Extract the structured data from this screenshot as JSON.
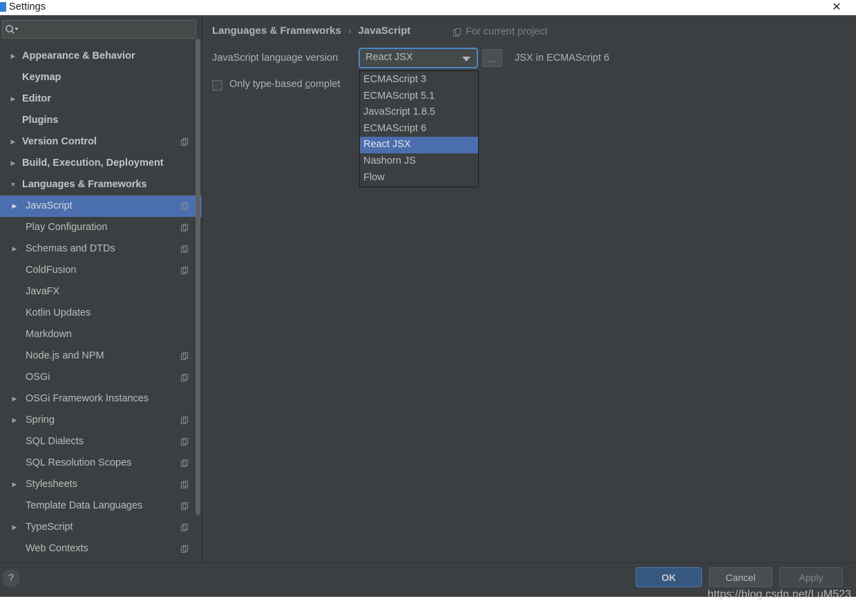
{
  "window": {
    "title": "Settings",
    "icon": "app-icon",
    "close_label": "✕"
  },
  "sidebar": {
    "search": {
      "placeholder": "",
      "value": "",
      "icon": "search-icon"
    },
    "items": [
      {
        "label": "Appearance & Behavior",
        "level": 0,
        "arrow": "▶",
        "expanded": false,
        "project_icon": false,
        "selected": false
      },
      {
        "label": "Keymap",
        "level": 0,
        "arrow": "",
        "expanded": false,
        "project_icon": false,
        "selected": false
      },
      {
        "label": "Editor",
        "level": 0,
        "arrow": "▶",
        "expanded": false,
        "project_icon": false,
        "selected": false
      },
      {
        "label": "Plugins",
        "level": 0,
        "arrow": "",
        "expanded": false,
        "project_icon": false,
        "selected": false
      },
      {
        "label": "Version Control",
        "level": 0,
        "arrow": "▶",
        "expanded": false,
        "project_icon": true,
        "selected": false
      },
      {
        "label": "Build, Execution, Deployment",
        "level": 0,
        "arrow": "▶",
        "expanded": false,
        "project_icon": false,
        "selected": false
      },
      {
        "label": "Languages & Frameworks",
        "level": 0,
        "arrow": "▼",
        "expanded": true,
        "project_icon": false,
        "selected": false
      },
      {
        "label": "JavaScript",
        "level": 1,
        "arrow": "▶",
        "expanded": false,
        "project_icon": true,
        "selected": true
      },
      {
        "label": "Play Configuration",
        "level": 1,
        "arrow": "",
        "expanded": false,
        "project_icon": true,
        "selected": false
      },
      {
        "label": "Schemas and DTDs",
        "level": 1,
        "arrow": "▶",
        "expanded": false,
        "project_icon": true,
        "selected": false
      },
      {
        "label": "ColdFusion",
        "level": 1,
        "arrow": "",
        "expanded": false,
        "project_icon": true,
        "selected": false
      },
      {
        "label": "JavaFX",
        "level": 1,
        "arrow": "",
        "expanded": false,
        "project_icon": false,
        "selected": false
      },
      {
        "label": "Kotlin Updates",
        "level": 1,
        "arrow": "",
        "expanded": false,
        "project_icon": false,
        "selected": false
      },
      {
        "label": "Markdown",
        "level": 1,
        "arrow": "",
        "expanded": false,
        "project_icon": false,
        "selected": false
      },
      {
        "label": "Node.js and NPM",
        "level": 1,
        "arrow": "",
        "expanded": false,
        "project_icon": true,
        "selected": false
      },
      {
        "label": "OSGi",
        "level": 1,
        "arrow": "",
        "expanded": false,
        "project_icon": true,
        "selected": false
      },
      {
        "label": "OSGi Framework Instances",
        "level": 1,
        "arrow": "▶",
        "expanded": false,
        "project_icon": false,
        "selected": false
      },
      {
        "label": "Spring",
        "level": 1,
        "arrow": "▶",
        "expanded": false,
        "project_icon": true,
        "selected": false
      },
      {
        "label": "SQL Dialects",
        "level": 1,
        "arrow": "",
        "expanded": false,
        "project_icon": true,
        "selected": false
      },
      {
        "label": "SQL Resolution Scopes",
        "level": 1,
        "arrow": "",
        "expanded": false,
        "project_icon": true,
        "selected": false
      },
      {
        "label": "Stylesheets",
        "level": 1,
        "arrow": "▶",
        "expanded": false,
        "project_icon": true,
        "selected": false
      },
      {
        "label": "Template Data Languages",
        "level": 1,
        "arrow": "",
        "expanded": false,
        "project_icon": true,
        "selected": false
      },
      {
        "label": "TypeScript",
        "level": 1,
        "arrow": "▶",
        "expanded": false,
        "project_icon": true,
        "selected": false
      },
      {
        "label": "Web Contexts",
        "level": 1,
        "arrow": "",
        "expanded": false,
        "project_icon": true,
        "selected": false
      }
    ]
  },
  "content": {
    "breadcrumb": {
      "parent": "Languages & Frameworks",
      "separator": "›",
      "current": "JavaScript"
    },
    "scope": {
      "icon": "project-scope-icon",
      "label": "For current project"
    },
    "language_version": {
      "label": "JavaScript language version",
      "selected": "React JSX",
      "ellipsis_button": "...",
      "hint": "JSX in ECMAScript 6",
      "options": [
        "ECMAScript 3",
        "ECMAScript 5.1",
        "JavaScript 1.8.5",
        "ECMAScript 6",
        "React JSX",
        "Nashorn JS",
        "Flow"
      ],
      "highlighted_option": "React JSX"
    },
    "checkbox": {
      "label_before": "Only type-based ",
      "label_mnemonic": "c",
      "label_after": "omplet",
      "checked": false
    }
  },
  "footer": {
    "help": "?",
    "ok": "OK",
    "cancel": "Cancel",
    "apply": "Apply",
    "watermark": "https://blog.csdn.net/LuM523"
  },
  "colors": {
    "background": "#3c3f41",
    "selection": "#4b6eaf",
    "accent_focus": "#4a88c7",
    "ok_button": "#365880",
    "text": "#bbbbbb",
    "muted_text": "#7d8082",
    "titlebar": "#ffffff"
  }
}
